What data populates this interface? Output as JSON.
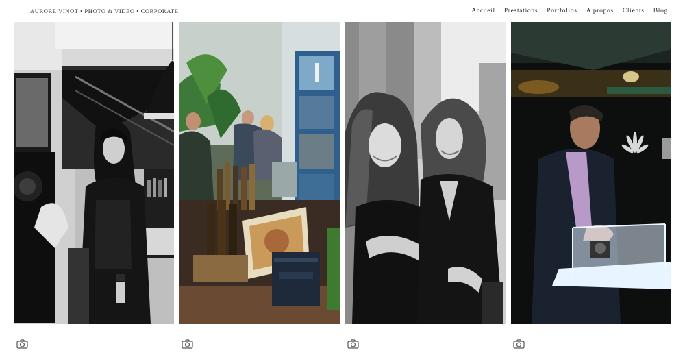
{
  "site": {
    "brand": "AURORE VINOT • PHOTO & VIDEO • CORPORATE"
  },
  "nav": {
    "items": [
      {
        "label": "Accueil"
      },
      {
        "label": "Prestations"
      },
      {
        "label": "Portfolios"
      },
      {
        "label": "A propos"
      },
      {
        "label": "Clients"
      },
      {
        "label": "Blog"
      }
    ]
  },
  "gallery": {
    "photos": [
      {
        "subject": "woman-in-bar-portrait",
        "style": "black-and-white"
      },
      {
        "subject": "event-bar-with-bottles",
        "style": "color"
      },
      {
        "subject": "two-women-portrait",
        "style": "black-and-white"
      },
      {
        "subject": "man-at-display-case",
        "style": "color-dark"
      }
    ],
    "icon": "camera-icon"
  }
}
